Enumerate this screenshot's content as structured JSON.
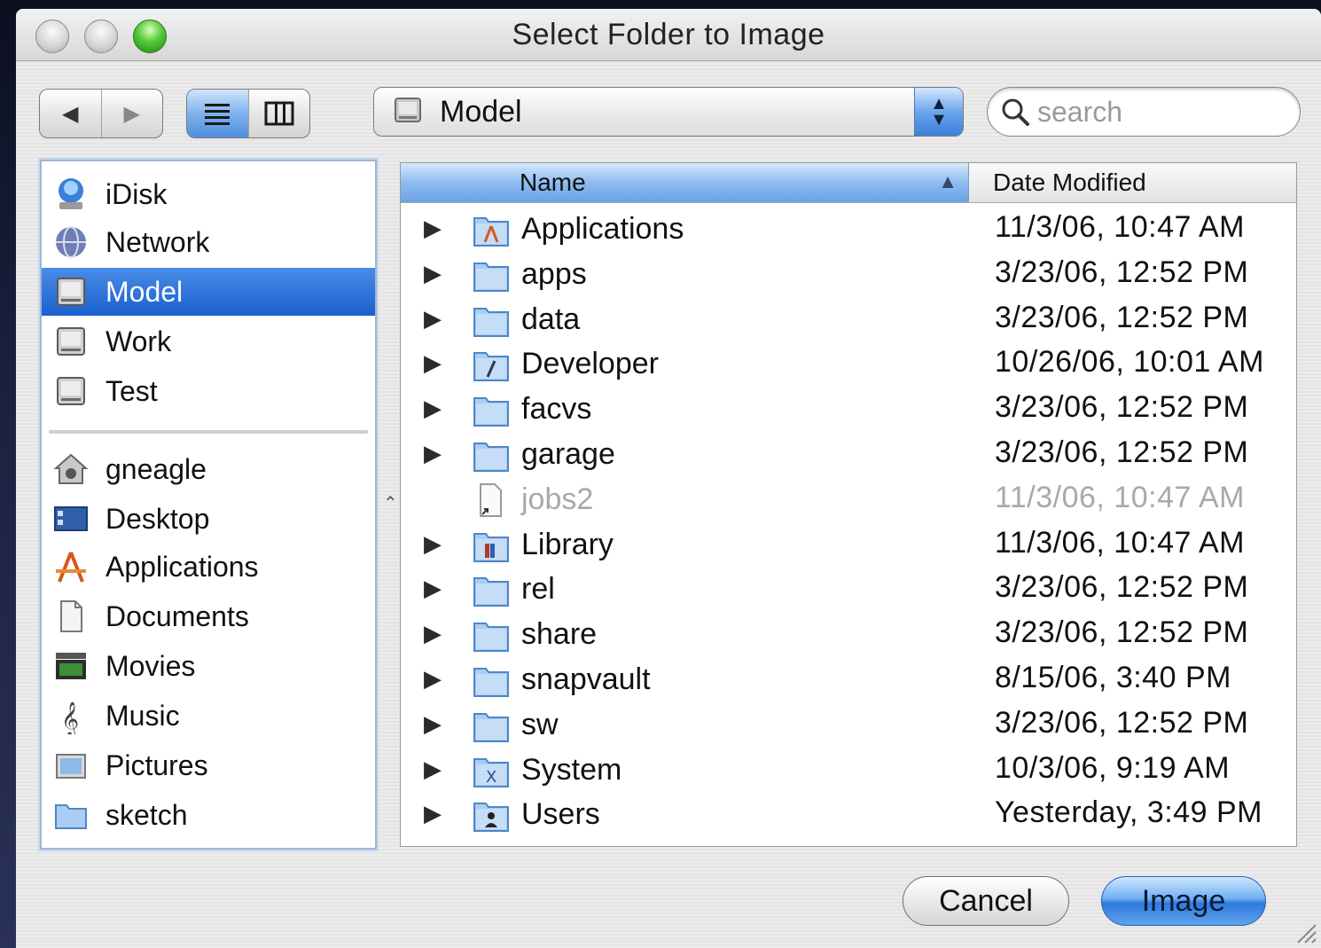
{
  "window": {
    "title": "Select Folder to Image"
  },
  "toolbar": {
    "back_glyph": "◀",
    "forward_glyph": "▶",
    "list_view_glyph": "☰",
    "column_view_glyph": "▥",
    "location": "Model",
    "search_placeholder": "search"
  },
  "sidebar": {
    "devices": [
      {
        "label": "iDisk",
        "icon": "idisk-icon"
      },
      {
        "label": "Network",
        "icon": "network-icon"
      },
      {
        "label": "Model",
        "icon": "hard-disk-icon",
        "selected": true
      },
      {
        "label": "Work",
        "icon": "hard-disk-icon"
      },
      {
        "label": "Test",
        "icon": "hard-disk-icon"
      }
    ],
    "places": [
      {
        "label": "gneagle",
        "icon": "home-icon"
      },
      {
        "label": "Desktop",
        "icon": "desktop-icon"
      },
      {
        "label": "Applications",
        "icon": "applications-icon"
      },
      {
        "label": "Documents",
        "icon": "documents-icon"
      },
      {
        "label": "Movies",
        "icon": "movies-icon"
      },
      {
        "label": "Music",
        "icon": "music-icon"
      },
      {
        "label": "Pictures",
        "icon": "pictures-icon"
      },
      {
        "label": "sketch",
        "icon": "folder-icon"
      }
    ]
  },
  "list": {
    "columns": {
      "name": "Name",
      "date": "Date Modified",
      "sort_glyph": "▲"
    },
    "rows": [
      {
        "name": "Applications",
        "date": "11/3/06, 10:47 AM",
        "icon": "applications-folder-icon"
      },
      {
        "name": "apps",
        "date": "3/23/06, 12:52 PM",
        "icon": "folder-icon"
      },
      {
        "name": "data",
        "date": "3/23/06, 12:52 PM",
        "icon": "folder-icon"
      },
      {
        "name": "Developer",
        "date": "10/26/06, 10:01 AM",
        "icon": "developer-folder-icon"
      },
      {
        "name": "facvs",
        "date": "3/23/06, 12:52 PM",
        "icon": "folder-icon"
      },
      {
        "name": "garage",
        "date": "3/23/06, 12:52 PM",
        "icon": "folder-icon"
      },
      {
        "name": "jobs2",
        "date": "11/3/06, 10:47 AM",
        "icon": "alias-file-icon",
        "disabled": true
      },
      {
        "name": "Library",
        "date": "11/3/06, 10:47 AM",
        "icon": "library-folder-icon"
      },
      {
        "name": "rel",
        "date": "3/23/06, 12:52 PM",
        "icon": "folder-icon"
      },
      {
        "name": "share",
        "date": "3/23/06, 12:52 PM",
        "icon": "folder-icon"
      },
      {
        "name": "snapvault",
        "date": "8/15/06, 3:40 PM",
        "icon": "folder-icon"
      },
      {
        "name": "sw",
        "date": "3/23/06, 12:52 PM",
        "icon": "folder-icon"
      },
      {
        "name": "System",
        "date": "10/3/06, 9:19 AM",
        "icon": "system-folder-icon"
      },
      {
        "name": "Users",
        "date": "Yesterday, 3:49 PM",
        "icon": "users-folder-icon"
      }
    ],
    "disclosure_glyph": "▶"
  },
  "buttons": {
    "cancel": "Cancel",
    "image": "Image"
  },
  "colors": {
    "selection": "#1b5fcf",
    "accent": "#4f8fdc"
  }
}
